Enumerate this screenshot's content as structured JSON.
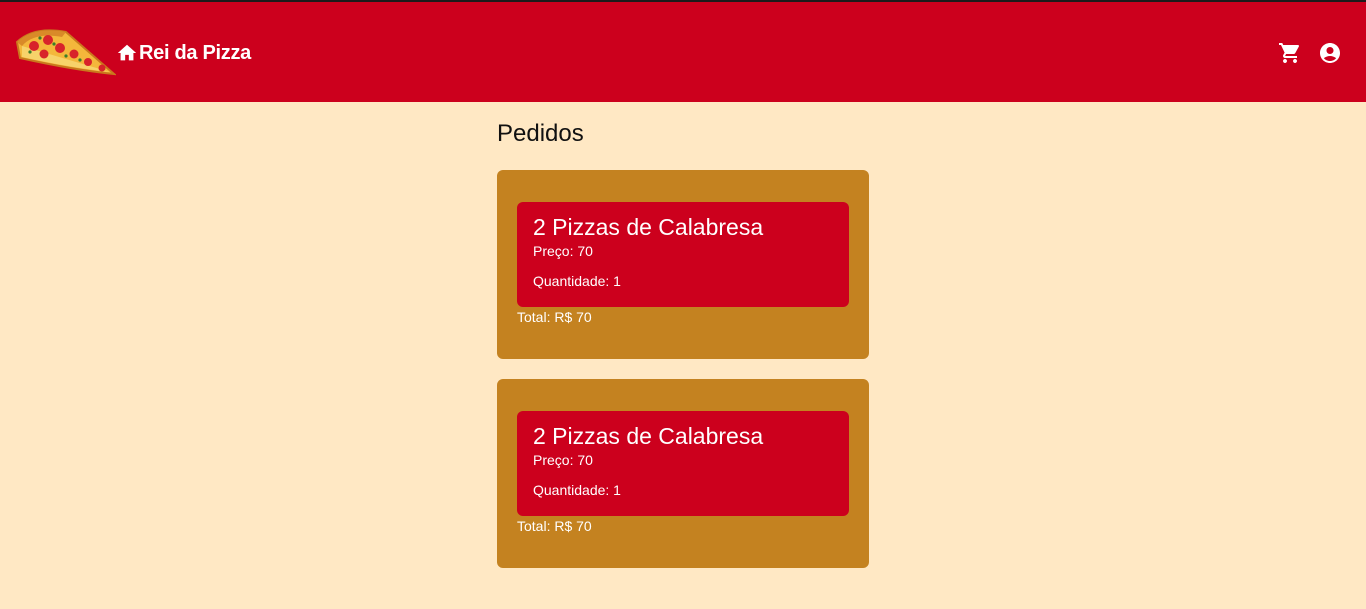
{
  "header": {
    "brand": "Rei da Pizza",
    "logo_icon": "pizza-slice-icon",
    "home_icon": "home-icon",
    "cart_icon": "shopping-cart-icon",
    "account_icon": "account-circle-icon",
    "background_color": "#cc001d"
  },
  "page": {
    "title": "Pedidos",
    "background_color": "#ffe8c4"
  },
  "orders": [
    {
      "items": [
        {
          "title": "2 Pizzas de Calabresa",
          "price_text": "Preço: 70",
          "quantity_text": "Quantidade: 1"
        }
      ],
      "total_text": "Total: R$ 70"
    },
    {
      "items": [
        {
          "title": "2 Pizzas de Calabresa",
          "price_text": "Preço: 70",
          "quantity_text": "Quantidade: 1"
        }
      ],
      "total_text": "Total: R$ 70"
    }
  ],
  "colors": {
    "order_card": "#c48220",
    "item_card": "#cc001d"
  }
}
